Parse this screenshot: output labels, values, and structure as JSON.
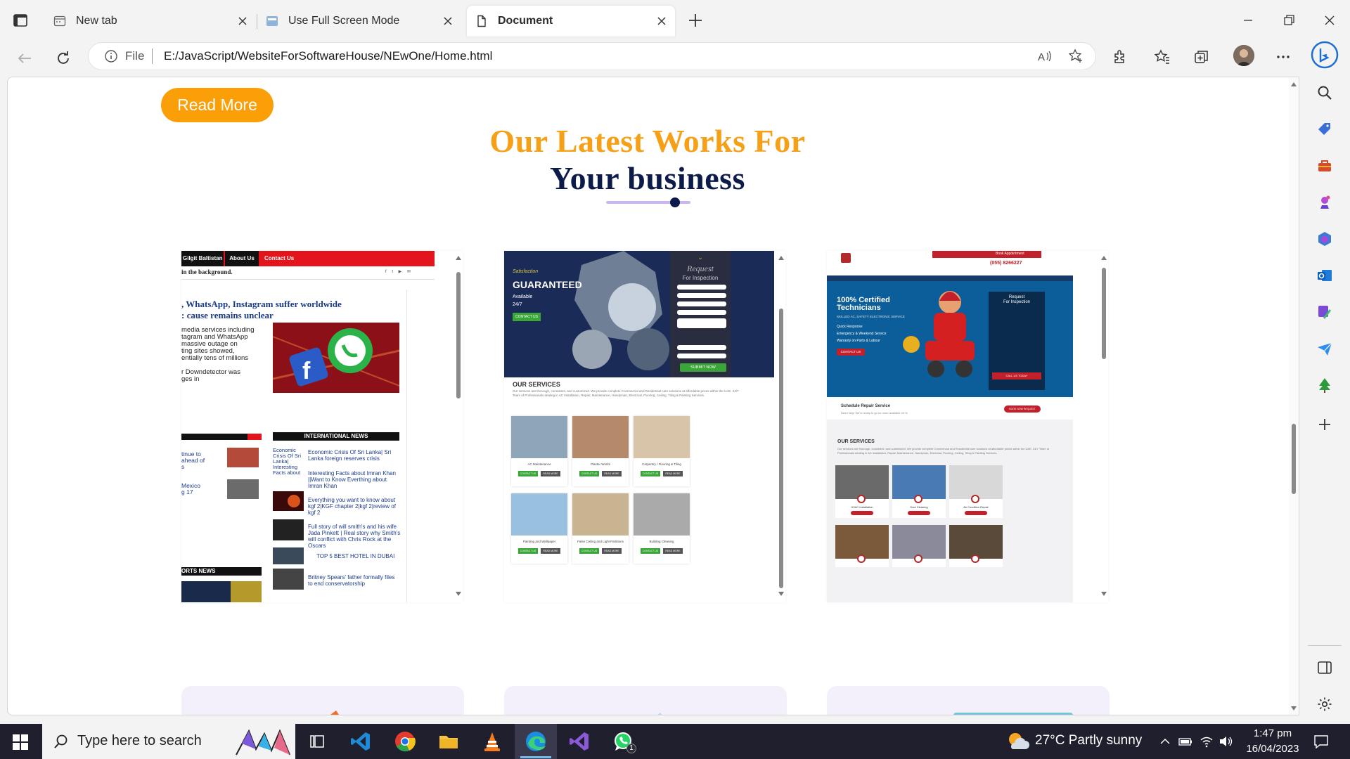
{
  "browser": {
    "tabs": [
      {
        "title": "New tab",
        "active": false
      },
      {
        "title": "Use Full Screen Mode",
        "active": false
      },
      {
        "title": "Document",
        "active": true
      }
    ],
    "address": {
      "scheme_label": "File",
      "url": "E:/JavaScript/WebsiteForSoftwareHouse/NEwOne/Home.html"
    }
  },
  "page": {
    "read_more_label": "Read More",
    "heading_line1": "Our Latest Works For",
    "heading_line2": "Your business",
    "colors": {
      "accent_orange": "#fb9f09",
      "heading_navy": "#0d1b4b",
      "underline_purple": "#c9b8f0"
    },
    "work_cards": [
      {
        "name": "news-site",
        "nav": [
          "Gilgit Baltistan",
          "About Us",
          "Contact Us"
        ],
        "strap": "in the background.",
        "headline": ", WhatsApp, Instagram suffer worldwide\n: cause remains unclear",
        "body": "media services including\ntagram and WhatsApp\nmassive outage on\nting sites showed,\nentially tens of millions\n\nr Downdetector was\nges in",
        "section_intl": "INTERNATIONAL NEWS",
        "left_items": "tinue to\n ahead of\ns\n\n\nMexico\ng 17",
        "intl_items": [
          "Economic Crisis Of Sri Lanka| Sri Lanka foreign reserves crisis",
          "Interesting Facts about Imran Khan ||Want to Know Everthing about Imran Khan",
          "Everything you want to know about kgf 2|KGF chapter 2|kgf 2|review of kgf 2",
          "Full story of will smith's and his wife Jada Pinkett | Real story why Smith's will conflict with Chris Rock at the Oscars",
          "TOP 5 BEST HOTEL IN DUBAI",
          "Britney Spears' father formally files to end conservatorship"
        ],
        "section_sports": "ORTS NEWS"
      },
      {
        "name": "home-services-green",
        "hero_small": "Satisfaction",
        "hero_title": "GUARANTEED",
        "hero_sub": "Available\n24/7",
        "hero_btn": "CONTACT US",
        "form_title": "Request",
        "form_sub": "For Inspection",
        "form_submit": "SUBMIT NOW",
        "services_title": "OUR SERVICES",
        "services_text": "Our services are thorough, consistent, and customized. We provide complete Commercial and Residential care solutions at affordable prices within the UAE. 24/7 Team of Professionals dealing in AC Installation, Repair, Maintenance, Handyman, Electrical, Flooring, Ceiling, Tiling & Painting Services.",
        "services": [
          "AC Maintenance",
          "Plaster Works",
          "Carpentry / Flooring & Tiling",
          "Painting and Wallpaper",
          "False Ceiling and Light Partitions",
          "Building Cleaning"
        ],
        "btn_contact": "CONTACT US",
        "btn_more": "READ MORE"
      },
      {
        "name": "technicians-blue",
        "phone": "(055) 8266227",
        "book": "Book Appointment",
        "hero_title": "100% Certified\nTechnicians",
        "hero_sub": "SKILLED AC, SAFETY ELECTRONIC SERVICE",
        "hero_list": [
          "Quick Response",
          "Emergency & Weekend Service",
          "Warranty on Parts & Labour"
        ],
        "hero_btn": "CONTACT US",
        "form_title": "Request\nFor Inspection",
        "form_btn": "CALL US TODAY",
        "schedule": "Schedule Repair Service",
        "schedule_sub": "Need help! We're ready to go no more available 24 %",
        "schedule_btn": "BOOK NOW REQUEST",
        "services_title": "OUR SERVICES",
        "services_text": "Our services are thorough, consistent, and customized. We provide complete Commercial and Residential care solutions at affordable prices within the UAE. 24/7 Team of Professionals dealing in AC Installation, Repair, Maintenance, Handyman, Electrical, Flooring, Ceiling, Tiling & Painting Services.",
        "services": [
          "HVAC Installation",
          "Duct Cleaning",
          "Air Condition Repair"
        ]
      }
    ]
  },
  "taskbar": {
    "search_placeholder": "Type here to search",
    "weather": "27°C  Partly sunny",
    "time": "1:47 pm",
    "date": "16/04/2023",
    "whatsapp_badge": "1"
  }
}
